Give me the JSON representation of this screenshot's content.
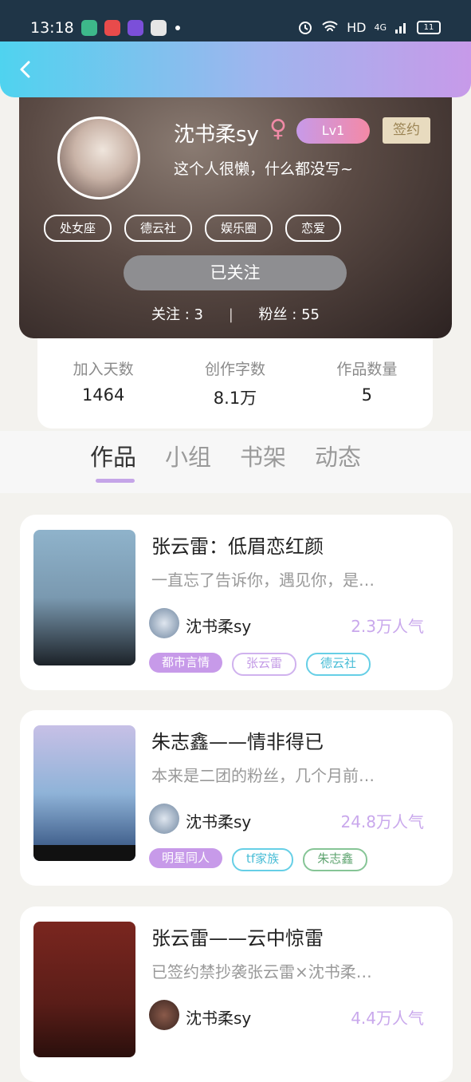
{
  "status_bar": {
    "time": "13:18",
    "network": "HD",
    "signal": "4G",
    "battery": "11"
  },
  "profile": {
    "name": "沈书柔sy",
    "gender_symbol": "♀",
    "level": "Lv1",
    "signed_badge": "签约",
    "bio": "这个人很懒，什么都没写~",
    "tags": [
      "处女座",
      "德云社",
      "娱乐圈",
      "恋爱"
    ],
    "follow_button": "已关注",
    "following_label": "关注",
    "following_count": "3",
    "fans_label": "粉丝",
    "fans_count": "55"
  },
  "stats": [
    {
      "label": "加入天数",
      "value": "1464"
    },
    {
      "label": "创作字数",
      "value": "8.1万"
    },
    {
      "label": "作品数量",
      "value": "5"
    }
  ],
  "tabs": [
    "作品",
    "小组",
    "书架",
    "动态"
  ],
  "works": [
    {
      "title": "张云雷：低眉恋红颜",
      "excerpt": "一直忘了告诉你，遇见你，是…",
      "author": "沈书柔sy",
      "popularity": "2.3万人气",
      "tags": [
        "都市言情",
        "张云雷",
        "德云社"
      ]
    },
    {
      "title": "朱志鑫——情非得已",
      "excerpt": "本来是二团的粉丝，几个月前…",
      "author": "沈书柔sy",
      "popularity": "24.8万人气",
      "tags": [
        "明星同人",
        "tf家族",
        "朱志鑫"
      ]
    },
    {
      "title": "张云雷——云中惊雷",
      "excerpt": "已签约禁抄袭张云雷×沈书柔…",
      "author": "沈书柔sy",
      "popularity": "4.4万人气",
      "tags": []
    }
  ],
  "colors": {
    "accent": "#c79ae9",
    "header_start": "#4fd3ef",
    "header_end": "#c79ae9"
  }
}
